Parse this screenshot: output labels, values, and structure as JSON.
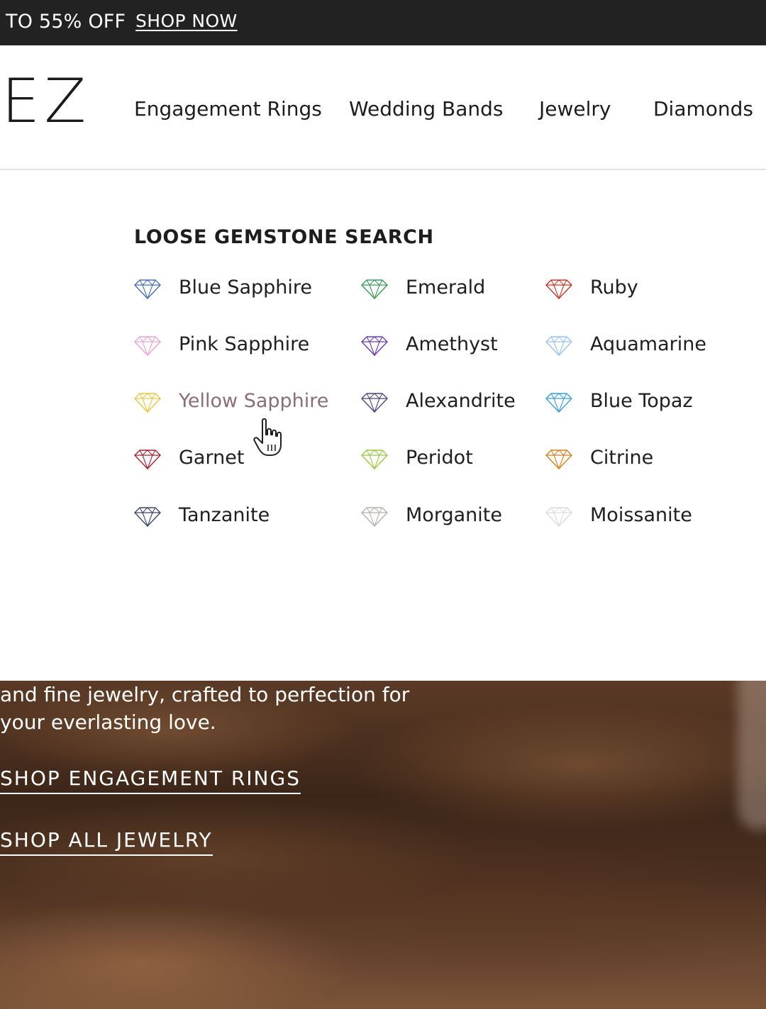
{
  "promo": {
    "text": "TO 55% OFF",
    "link": "SHOP NOW"
  },
  "header": {
    "logo": "EZ"
  },
  "nav": [
    {
      "label": "Engagement Rings"
    },
    {
      "label": "Wedding Bands"
    },
    {
      "label": "Jewelry"
    },
    {
      "label": "Diamonds"
    }
  ],
  "gemstone_menu": {
    "title": "LOOSE GEMSTONE SEARCH",
    "items": [
      {
        "label": "Blue Sapphire",
        "color": "#4a6fb3",
        "icon": "diamond-icon"
      },
      {
        "label": "Pink Sapphire",
        "color": "#e8a6d4",
        "icon": "diamond-icon"
      },
      {
        "label": "Yellow Sapphire",
        "color": "#e8c64a",
        "icon": "diamond-icon",
        "hovered": true
      },
      {
        "label": "Garnet",
        "color": "#a02434",
        "icon": "diamond-icon"
      },
      {
        "label": "Tanzanite",
        "color": "#3c4668",
        "icon": "diamond-icon"
      },
      {
        "label": "Emerald",
        "color": "#3e9a5a",
        "icon": "diamond-icon"
      },
      {
        "label": "Amethyst",
        "color": "#6a3ea6",
        "icon": "diamond-icon"
      },
      {
        "label": "Alexandrite",
        "color": "#4c4a78",
        "icon": "diamond-icon"
      },
      {
        "label": "Peridot",
        "color": "#9cc84a",
        "icon": "diamond-icon"
      },
      {
        "label": "Morganite",
        "color": "#b8b0ac",
        "icon": "diamond-icon"
      },
      {
        "label": "Ruby",
        "color": "#c0392b",
        "icon": "diamond-icon"
      },
      {
        "label": "Aquamarine",
        "color": "#9cc4ec",
        "icon": "diamond-icon"
      },
      {
        "label": "Blue Topaz",
        "color": "#3f9fd0",
        "icon": "diamond-icon"
      },
      {
        "label": "Citrine",
        "color": "#d47f24",
        "icon": "diamond-icon"
      },
      {
        "label": "Moissanite",
        "color": "#dcdcdc",
        "icon": "diamond-icon"
      }
    ]
  },
  "hero": {
    "text": "and fine jewelry, crafted to perfection for your everlasting love.",
    "links": [
      {
        "label": "SHOP ENGAGEMENT RINGS"
      },
      {
        "label": "SHOP ALL JEWELRY"
      }
    ]
  }
}
